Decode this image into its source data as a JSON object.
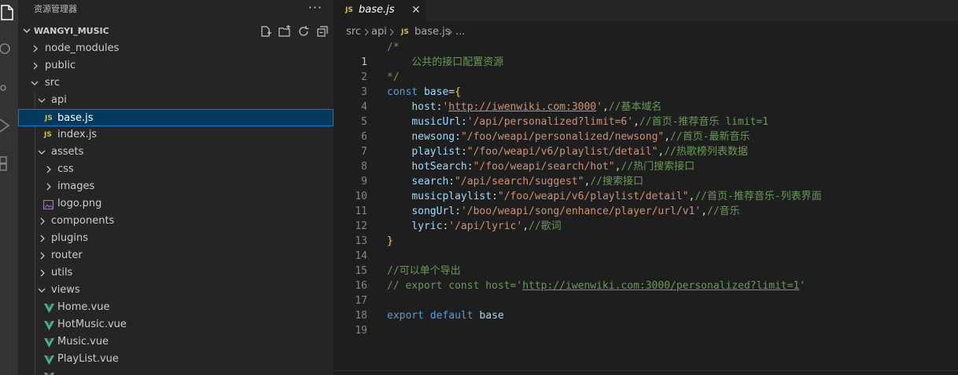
{
  "sidebar": {
    "title": "资源管理器",
    "more": "···",
    "project_name": "WANGYI_MUSIC",
    "tree": [
      {
        "label": "node_modules",
        "type": "folder",
        "expanded": false
      },
      {
        "label": "public",
        "type": "folder",
        "expanded": false
      },
      {
        "label": "src",
        "type": "folder",
        "expanded": true
      },
      {
        "label": "api",
        "type": "folder",
        "expanded": true
      },
      {
        "label": "base.js",
        "type": "js",
        "icon": "JS",
        "selected": true
      },
      {
        "label": "index.js",
        "type": "js",
        "icon": "JS"
      },
      {
        "label": "assets",
        "type": "folder",
        "expanded": true
      },
      {
        "label": "css",
        "type": "folder",
        "expanded": false
      },
      {
        "label": "images",
        "type": "folder",
        "expanded": false
      },
      {
        "label": "logo.png",
        "type": "image"
      },
      {
        "label": "components",
        "type": "folder",
        "expanded": false
      },
      {
        "label": "plugins",
        "type": "folder",
        "expanded": false
      },
      {
        "label": "router",
        "type": "folder",
        "expanded": false
      },
      {
        "label": "utils",
        "type": "folder",
        "expanded": false
      },
      {
        "label": "views",
        "type": "folder",
        "expanded": true
      },
      {
        "label": "Home.vue",
        "type": "vue"
      },
      {
        "label": "HotMusic.vue",
        "type": "vue"
      },
      {
        "label": "Music.vue",
        "type": "vue"
      },
      {
        "label": "PlayList.vue",
        "type": "vue"
      }
    ]
  },
  "tab": {
    "icon": "JS",
    "name": "base.js",
    "close": "✕"
  },
  "breadcrumb": {
    "src": "src",
    "api": "api",
    "icon": "JS",
    "file": "base.js",
    "more": "..."
  },
  "code": {
    "line_numbers": [
      "1",
      "2",
      "3",
      "4",
      "5",
      "6",
      "7",
      "8",
      "9",
      "10",
      "11",
      "12",
      "13",
      "14",
      "15",
      "16",
      "17",
      "18",
      "19"
    ],
    "l1": "/*",
    "l2": "    公共的接口配置资源",
    "l3": "*/",
    "l4_kw": "const",
    "l4_name": "base",
    "l4_eq": "=",
    "l4_brace": "{",
    "l5_prop": "host",
    "l5_colon": ":",
    "l5_q1": "'",
    "l5_url": "http://iwenwiki.com:3000",
    "l5_q2": "'",
    "l5_comma": ",",
    "l5_comment": "//基本域名",
    "l6_prop": "musicUrl",
    "l6_val": "'/api/personalized?limit=6'",
    "l6_comment": "//首页-推荐音乐 limit=1",
    "l7_prop": "newsong",
    "l7_val": "\"/foo/weapi/personalized/newsong\"",
    "l7_comment": "//首页-最新音乐",
    "l8_prop": "playlist",
    "l8_val": "\"/foo/weapi/v6/playlist/detail\"",
    "l8_comment": "//热歌榜列表数据",
    "l9_prop": "hotSearch",
    "l9_val": "\"/foo/weapi/search/hot\"",
    "l9_comment": "//热门搜索接口",
    "l10_prop": "search",
    "l10_val": "\"/api/search/suggest\"",
    "l10_comment": "//搜索接口",
    "l11_prop": "musicplaylist",
    "l11_val": "\"/foo/weapi/v6/playlist/detail\"",
    "l11_comment": "//首页-推荐音乐-列表界面",
    "l12_prop": "songUrl",
    "l12_val": "'/boo/weapi/song/enhance/player/url/v1'",
    "l12_comment": "//音乐",
    "l13_prop": "lyric",
    "l13_val": "'/api/lyric'",
    "l13_comment": "//歌词",
    "l14_brace": "}",
    "l16": "//可以单个导出",
    "l17_prefix": "// export const host='",
    "l17_url": "http://iwenwiki.com:3000/personalized?limit=1",
    "l17_suffix": "'",
    "l19_kw1": "export",
    "l19_kw2": "default",
    "l19_name": "base"
  },
  "colors": {
    "accent": "#007fd4",
    "selection": "#04395e",
    "js_icon": "#d7ba44",
    "vue_icon": "#41b883",
    "folder_text": "#cccccc"
  }
}
